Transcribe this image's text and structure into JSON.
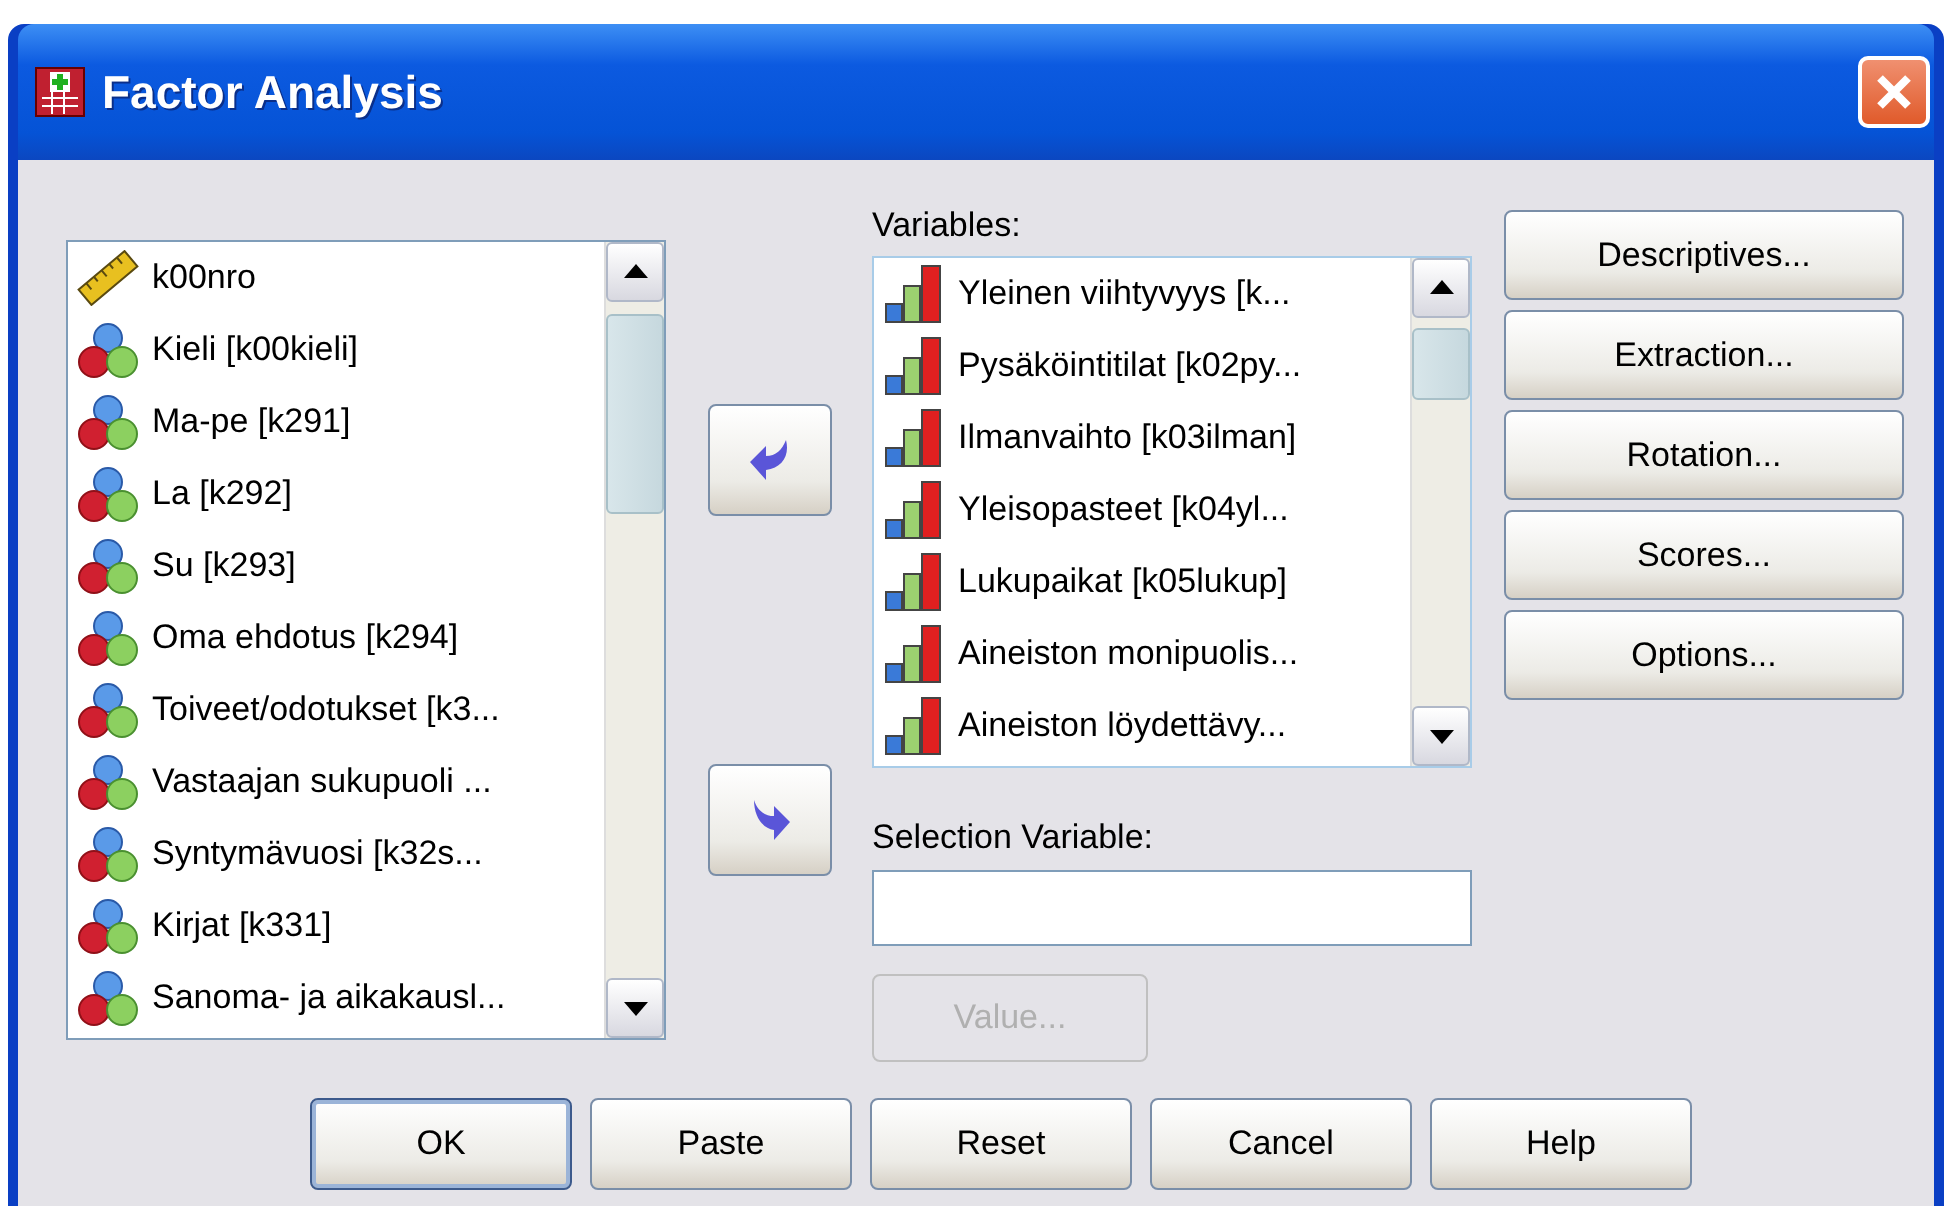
{
  "window": {
    "title": "Factor Analysis"
  },
  "source_list": {
    "items": [
      {
        "label": "k00nro",
        "kind": "scale"
      },
      {
        "label": "Kieli [k00kieli]",
        "kind": "nominal"
      },
      {
        "label": "Ma-pe [k291]",
        "kind": "nominal"
      },
      {
        "label": "La [k292]",
        "kind": "nominal"
      },
      {
        "label": "Su [k293]",
        "kind": "nominal"
      },
      {
        "label": "Oma ehdotus [k294]",
        "kind": "nominal"
      },
      {
        "label": "Toiveet/odotukset [k3...",
        "kind": "nominal"
      },
      {
        "label": "Vastaajan sukupuoli ...",
        "kind": "nominal"
      },
      {
        "label": "Syntymävuosi [k32s...",
        "kind": "nominal"
      },
      {
        "label": "Kirjat [k331]",
        "kind": "nominal"
      },
      {
        "label": "Sanoma- ja aikakausl...",
        "kind": "nominal"
      }
    ]
  },
  "move_buttons": [
    {
      "kind": "left"
    },
    {
      "kind": "right"
    }
  ],
  "variables": {
    "label": "Variables:",
    "items": [
      {
        "label": "Yleinen viihtyvyys [k...",
        "kind": "ordinal"
      },
      {
        "label": "Pysäköintitilat [k02py...",
        "kind": "ordinal"
      },
      {
        "label": "Ilmanvaihto [k03ilman]",
        "kind": "ordinal"
      },
      {
        "label": "Yleisopasteet [k04yl...",
        "kind": "ordinal"
      },
      {
        "label": "Lukupaikat [k05lukup]",
        "kind": "ordinal"
      },
      {
        "label": "Aineiston monipuolis...",
        "kind": "ordinal"
      },
      {
        "label": "Aineiston löydettävy...",
        "kind": "ordinal"
      }
    ]
  },
  "selection_variable": {
    "label": "Selection Variable:"
  },
  "value_button": {
    "label": "Value...",
    "disabled": true
  },
  "side_buttons": [
    {
      "label": "Descriptives..."
    },
    {
      "label": "Extraction..."
    },
    {
      "label": "Rotation..."
    },
    {
      "label": "Scores..."
    },
    {
      "label": "Options..."
    }
  ],
  "bottom_buttons": [
    {
      "label": "OK",
      "default": true
    },
    {
      "label": "Paste",
      "default": false
    },
    {
      "label": "Reset",
      "default": false
    },
    {
      "label": "Cancel",
      "default": false
    },
    {
      "label": "Help",
      "default": false
    }
  ]
}
